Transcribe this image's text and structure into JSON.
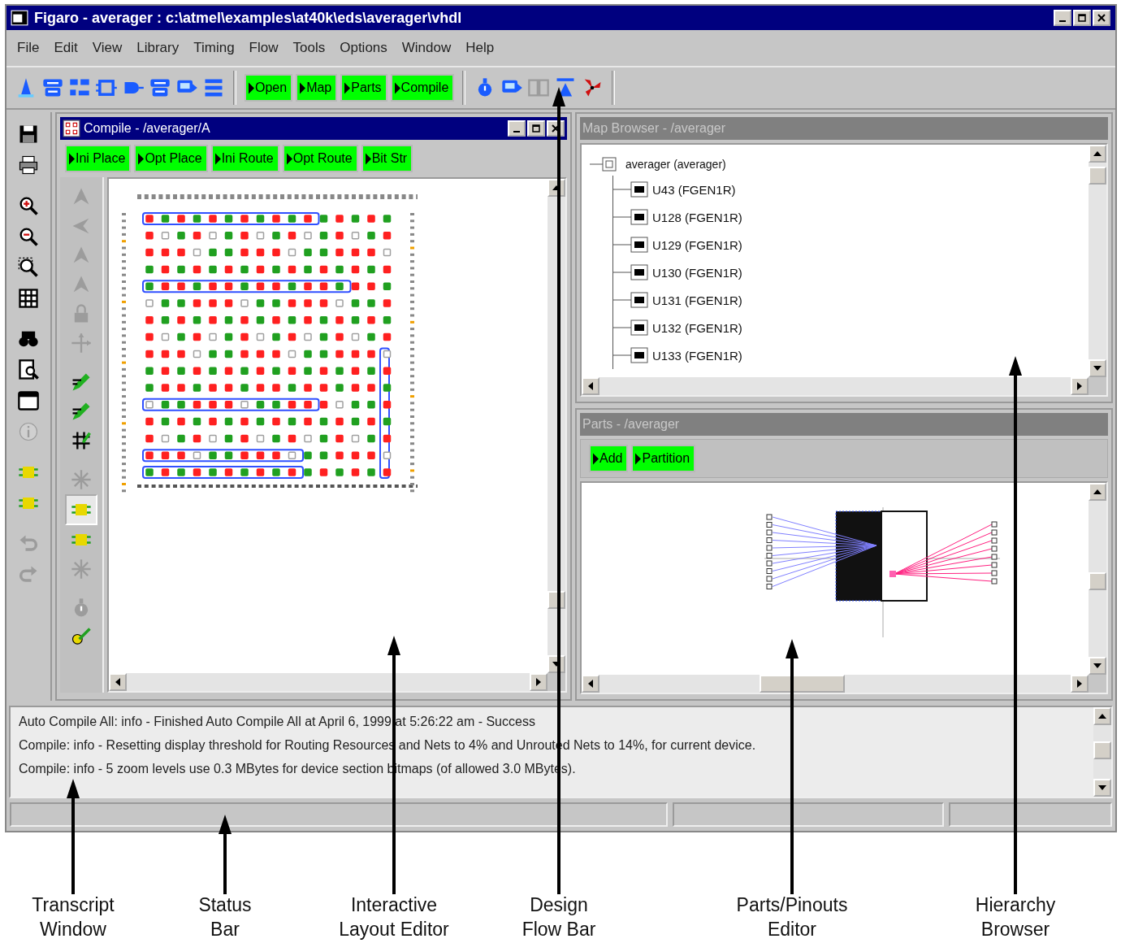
{
  "window": {
    "title": "Figaro - averager : c:\\atmel\\examples\\at40k\\eds\\averager\\vhdl"
  },
  "menu": [
    "File",
    "Edit",
    "View",
    "Library",
    "Timing",
    "Flow",
    "Tools",
    "Options",
    "Window",
    "Help"
  ],
  "toolbar": {
    "tools_left": [
      {
        "kind": "cone",
        "disabled": false
      },
      {
        "kind": "boards",
        "disabled": false
      },
      {
        "kind": "blocks",
        "disabled": false
      },
      {
        "kind": "chipbus",
        "disabled": false
      },
      {
        "kind": "gate",
        "disabled": false
      },
      {
        "kind": "boards",
        "disabled": false
      },
      {
        "kind": "monitor",
        "disabled": false
      },
      {
        "kind": "list",
        "disabled": false
      }
    ],
    "flow_buttons": [
      {
        "label": "Open"
      },
      {
        "label": "Map"
      },
      {
        "label": "Parts"
      },
      {
        "label": "Compile"
      }
    ],
    "tools_right": [
      {
        "kind": "stopwatch",
        "disabled": false
      },
      {
        "kind": "monitor",
        "disabled": false
      },
      {
        "kind": "split",
        "disabled": true
      },
      {
        "kind": "transmit",
        "disabled": false
      },
      {
        "kind": "pinwheel",
        "disabled": false
      }
    ]
  },
  "left_toolbar": [
    {
      "kind": "floppy",
      "disabled": false
    },
    {
      "kind": "printer",
      "disabled": false
    },
    {
      "kind": "zoomin",
      "disabled": false
    },
    {
      "kind": "zoomout",
      "disabled": false
    },
    {
      "kind": "zoombox",
      "disabled": false
    },
    {
      "kind": "grid",
      "disabled": false
    },
    {
      "kind": "binoculars",
      "disabled": false
    },
    {
      "kind": "docsearch",
      "disabled": false
    },
    {
      "kind": "window",
      "disabled": false
    },
    {
      "kind": "info",
      "disabled": true
    },
    {
      "kind": "chip",
      "disabled": false
    },
    {
      "kind": "chip",
      "disabled": false
    },
    {
      "kind": "undo",
      "disabled": true
    },
    {
      "kind": "redo",
      "disabled": true
    }
  ],
  "compile_window": {
    "title": "Compile - /averager/A",
    "active": true,
    "flow_buttons": [
      {
        "label": "Ini Place"
      },
      {
        "label": "Opt Place"
      },
      {
        "label": "Ini Route"
      },
      {
        "label": "Opt Route"
      },
      {
        "label": "Bit Str"
      }
    ],
    "tools": [
      {
        "kind": "arrowhead",
        "disabled": true,
        "selected": false
      },
      {
        "kind": "arrowleft",
        "disabled": true,
        "selected": false
      },
      {
        "kind": "arrowhead",
        "disabled": true,
        "selected": false
      },
      {
        "kind": "arrowhead",
        "disabled": true,
        "selected": false
      },
      {
        "kind": "lock",
        "disabled": true,
        "selected": false
      },
      {
        "kind": "move",
        "disabled": true,
        "selected": false
      },
      {
        "kind": "pencil",
        "disabled": false,
        "selected": false
      },
      {
        "kind": "pencil",
        "disabled": false,
        "selected": false
      },
      {
        "kind": "hash",
        "disabled": false,
        "selected": false
      },
      {
        "kind": "star",
        "disabled": true,
        "selected": false
      },
      {
        "kind": "chip",
        "disabled": false,
        "selected": true
      },
      {
        "kind": "chip",
        "disabled": false,
        "selected": false
      },
      {
        "kind": "star",
        "disabled": true,
        "selected": false
      },
      {
        "kind": "stopwatch",
        "disabled": true,
        "selected": false
      },
      {
        "kind": "brush",
        "disabled": false,
        "selected": false
      }
    ]
  },
  "map_browser": {
    "title": "Map Browser - /averager",
    "active": false,
    "tree": [
      {
        "label": "averager (averager)",
        "expanded": true,
        "children": [
          {
            "label": "U43 (FGEN1R)"
          },
          {
            "label": "U128 (FGEN1R)"
          },
          {
            "label": "U129 (FGEN1R)"
          },
          {
            "label": "U130 (FGEN1R)"
          },
          {
            "label": "U131 (FGEN1R)"
          },
          {
            "label": "U132 (FGEN1R)"
          },
          {
            "label": "U133 (FGEN1R)"
          }
        ]
      }
    ]
  },
  "parts_window": {
    "title": "Parts - /averager",
    "active": false,
    "flow_buttons": [
      {
        "label": "Add"
      },
      {
        "label": "Partition"
      }
    ]
  },
  "transcript": [
    "Auto Compile All: info - Finished Auto Compile All at April 6, 1999 at 5:26:22 am - Success",
    "Compile: info - Resetting display threshold for Routing Resources and Nets to 4% and Unrouted Nets to 14%, for current device.",
    "Compile: info - 5 zoom levels use 0.3 MBytes for device section bitmaps (of allowed 3.0 MBytes)."
  ],
  "annotations": [
    {
      "label": "Transcript\nWindow"
    },
    {
      "label": "Status\nBar"
    },
    {
      "label": "Interactive\nLayout Editor"
    },
    {
      "label": "Design\nFlow Bar"
    },
    {
      "label": "Parts/Pinouts\nEditor"
    },
    {
      "label": "Hierarchy\nBrowser"
    }
  ]
}
